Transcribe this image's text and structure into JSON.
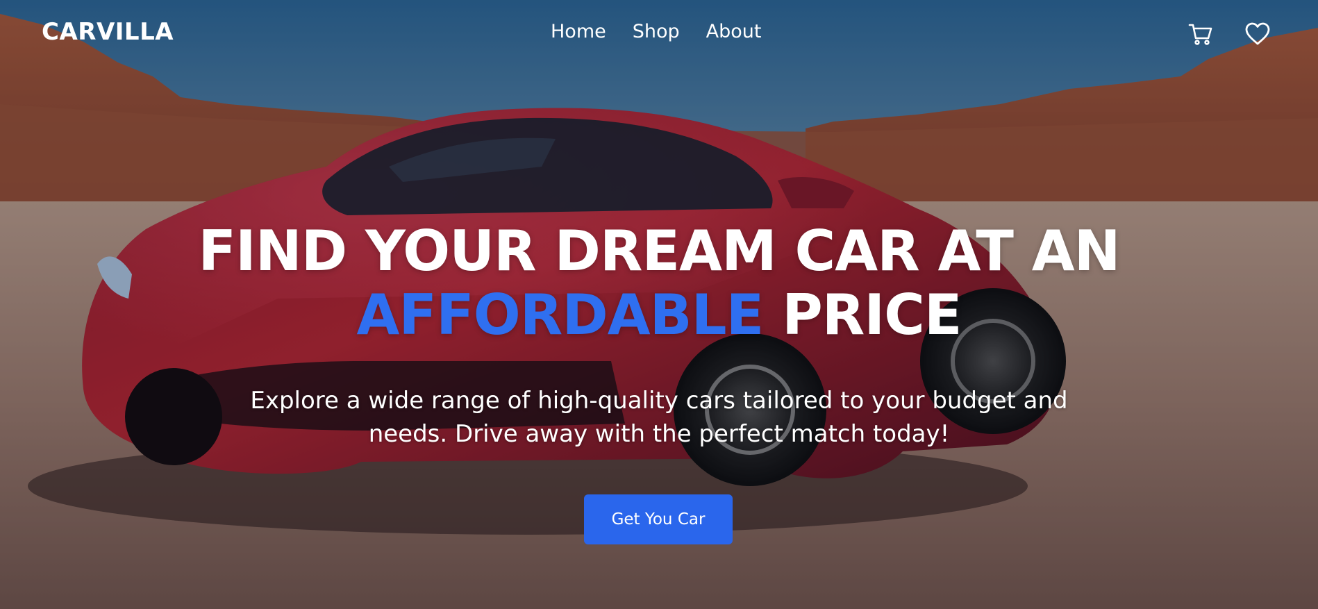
{
  "brand": {
    "logo": "CARVILLA"
  },
  "nav": {
    "links": [
      {
        "label": "Home"
      },
      {
        "label": "Shop"
      },
      {
        "label": "About"
      }
    ],
    "icons": [
      "cart-icon",
      "heart-icon"
    ]
  },
  "hero": {
    "title_line1": "FIND YOUR DREAM CAR AT AN",
    "title_accent": "AFFORDABLE",
    "title_line2_rest": " PRICE",
    "subtitle": "Explore a wide range of high-quality cars tailored to your budget and needs. Drive away with the perfect match today!",
    "cta_label": "Get You Car"
  },
  "colors": {
    "accent": "#2f6ff0",
    "button": "#2a66ec",
    "text": "#ffffff"
  }
}
